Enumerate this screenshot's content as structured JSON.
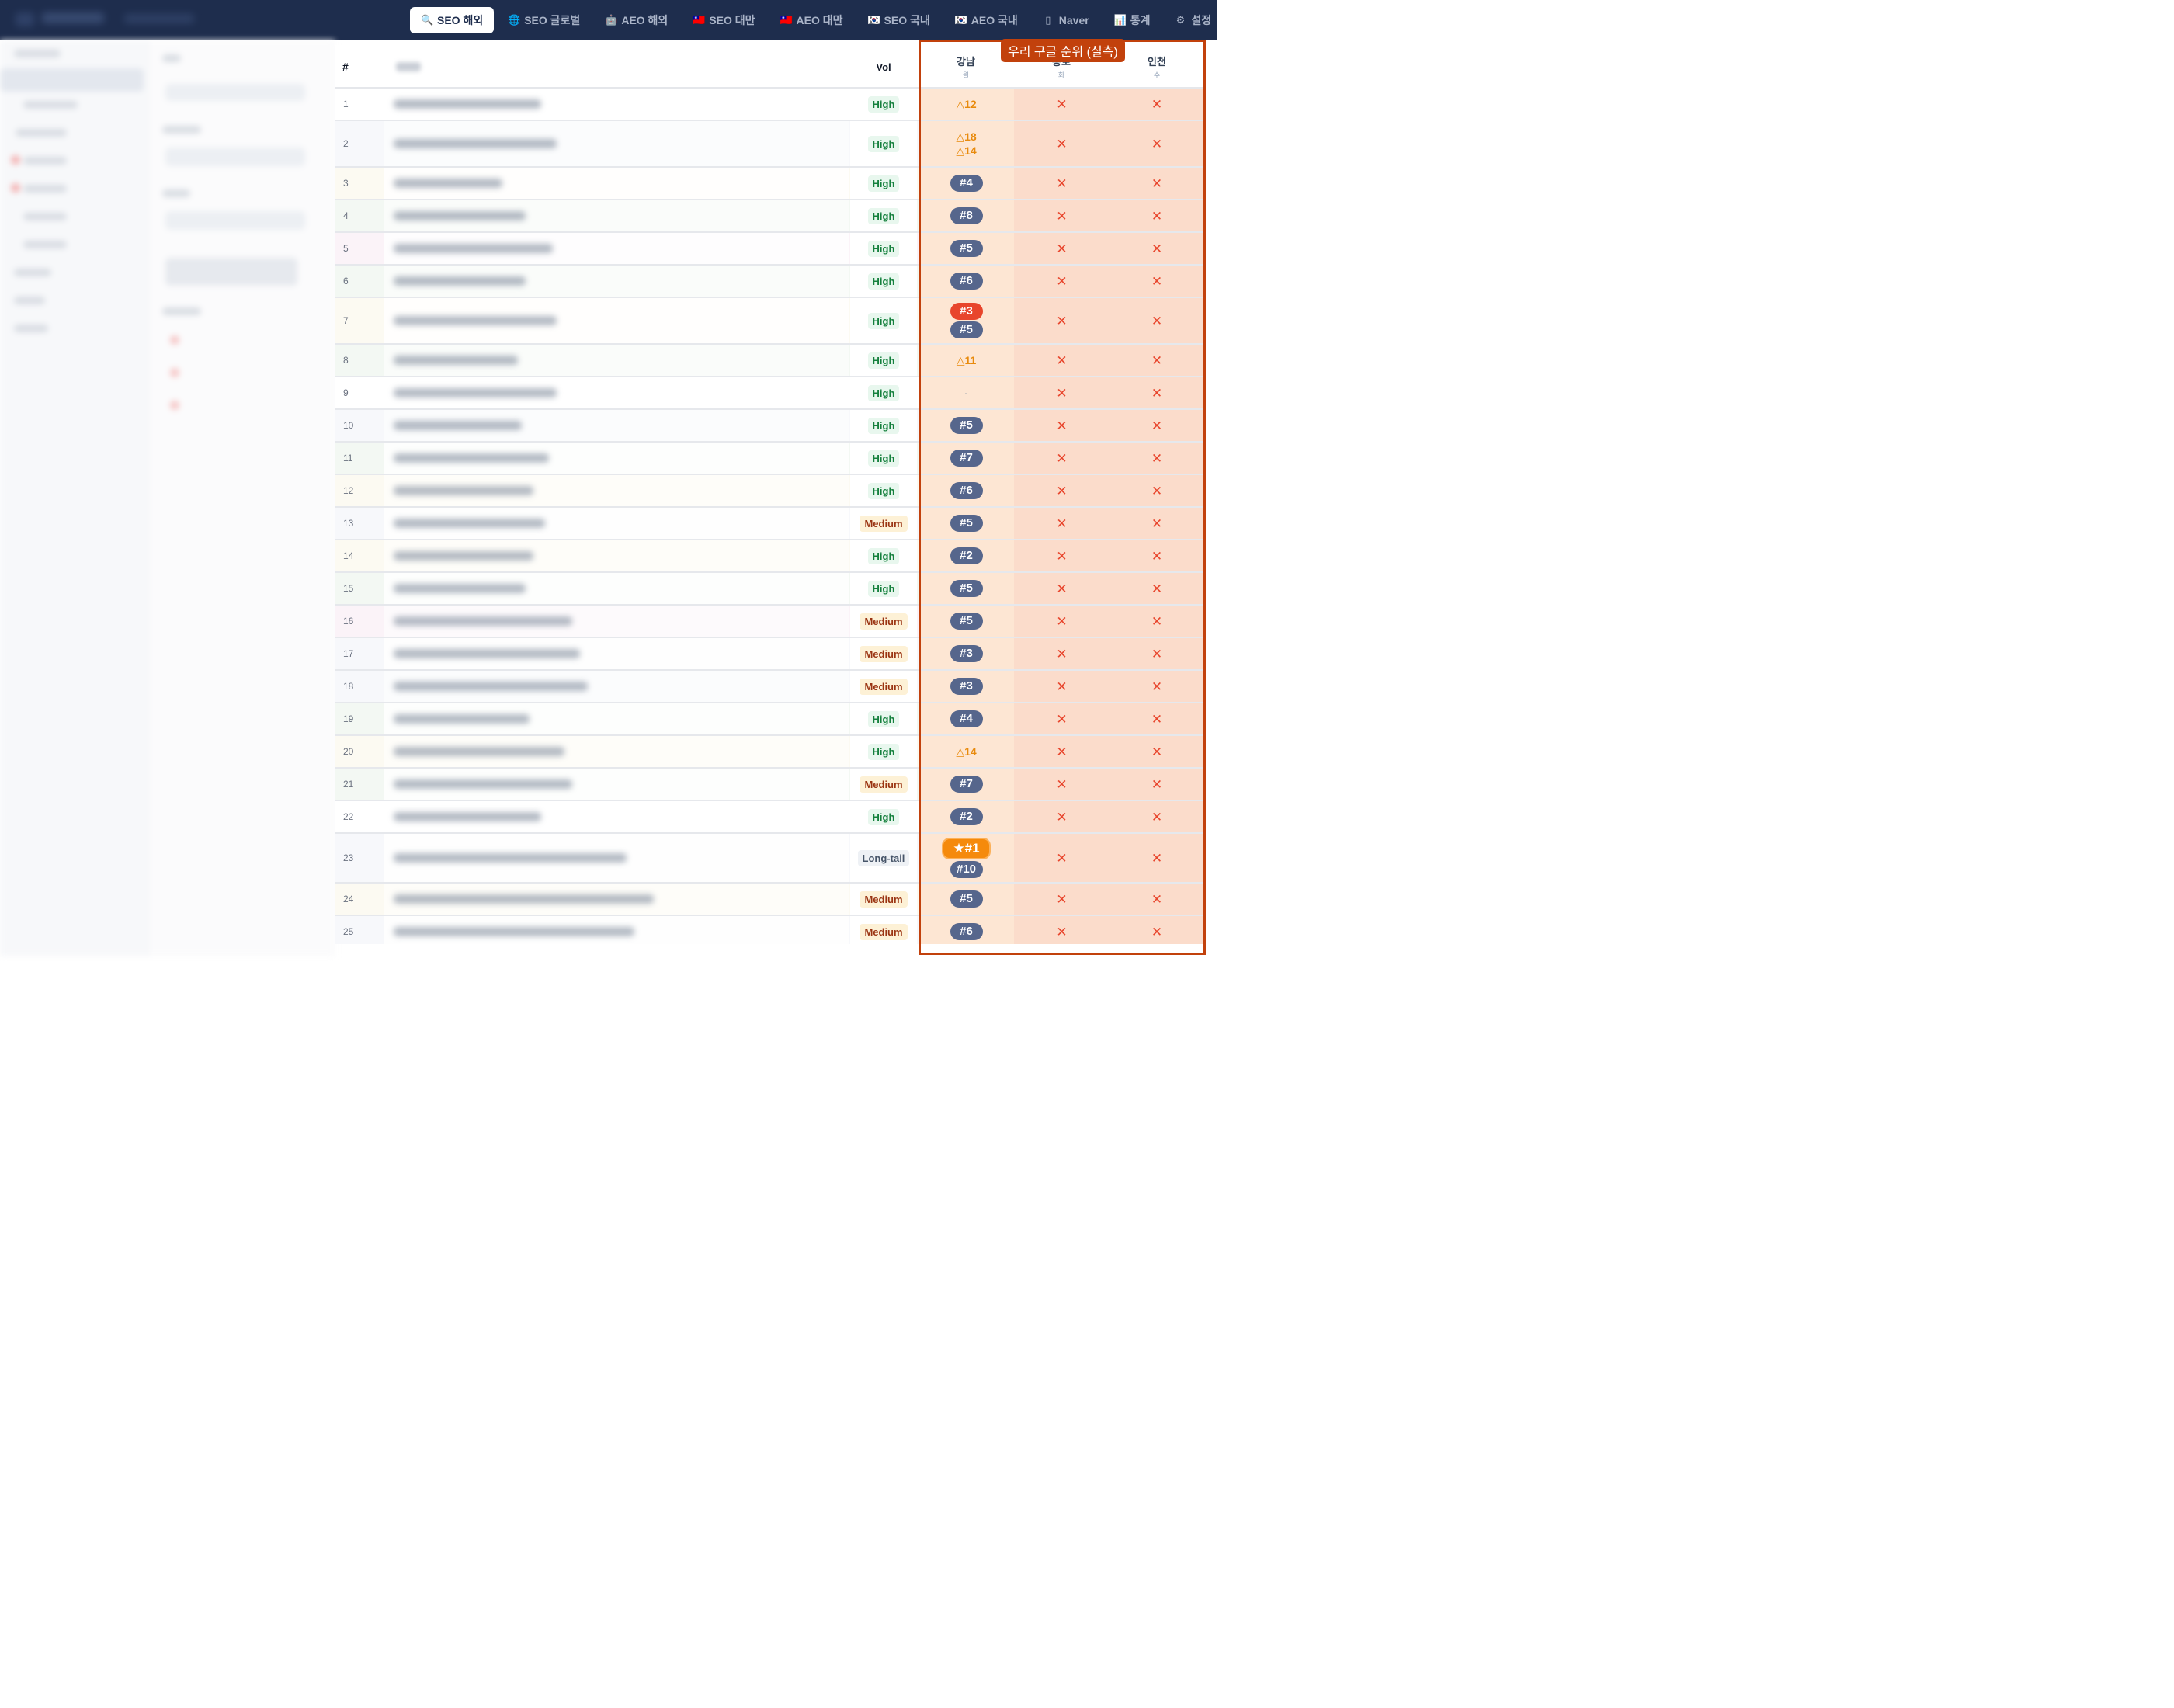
{
  "nav": {
    "tabs": [
      {
        "label": "SEO 해외",
        "icon": "search-icon",
        "glyph": "🔍",
        "active": true
      },
      {
        "label": "SEO 글로벌",
        "icon": "globe-icon",
        "glyph": "🌐",
        "active": false
      },
      {
        "label": "AEO 해외",
        "icon": "robot-icon",
        "glyph": "🤖",
        "active": false
      },
      {
        "label": "SEO 대만",
        "icon": "taiwan-flag-icon",
        "glyph": "🇹🇼",
        "active": false
      },
      {
        "label": "AEO 대만",
        "icon": "taiwan-flag-icon",
        "glyph": "🇹🇼",
        "active": false
      },
      {
        "label": "SEO 국내",
        "icon": "korea-flag-icon",
        "glyph": "🇰🇷",
        "active": false
      },
      {
        "label": "AEO 국내",
        "icon": "korea-flag-icon",
        "glyph": "🇰🇷",
        "active": false
      },
      {
        "label": "Naver",
        "icon": "naver-icon",
        "glyph": "▯",
        "active": false
      },
      {
        "label": "통계",
        "icon": "chart-icon",
        "glyph": "📊",
        "active": false
      },
      {
        "label": "설정",
        "icon": "gear-icon",
        "glyph": "⚙",
        "active": false
      }
    ]
  },
  "highlight": {
    "label": "우리 구글 순위 (실측)"
  },
  "table": {
    "headers": {
      "num": "#",
      "vol": "Vol",
      "locations": [
        {
          "name": "강남",
          "day": "월"
        },
        {
          "name": "종로",
          "day": "화"
        },
        {
          "name": "인천",
          "day": "수"
        }
      ]
    },
    "rows": [
      {
        "n": "1",
        "vol": "High",
        "vclass": "high",
        "rank": [
          {
            "t": "tri",
            "v": "△12"
          }
        ]
      },
      {
        "n": "2",
        "vol": "High",
        "vclass": "high",
        "rank": [
          {
            "t": "tri",
            "v": "△18"
          },
          {
            "t": "tri",
            "v": "△14"
          }
        ]
      },
      {
        "n": "3",
        "vol": "High",
        "vclass": "high",
        "rank": [
          {
            "t": "pill",
            "v": "#4"
          }
        ]
      },
      {
        "n": "4",
        "vol": "High",
        "vclass": "high",
        "rank": [
          {
            "t": "pill",
            "v": "#8"
          }
        ]
      },
      {
        "n": "5",
        "vol": "High",
        "vclass": "high",
        "rank": [
          {
            "t": "pill",
            "v": "#5"
          }
        ]
      },
      {
        "n": "6",
        "vol": "High",
        "vclass": "high",
        "rank": [
          {
            "t": "pill",
            "v": "#6"
          }
        ]
      },
      {
        "n": "7",
        "vol": "High",
        "vclass": "high",
        "rank": [
          {
            "t": "pill red",
            "v": "#3"
          },
          {
            "t": "pill",
            "v": "#5"
          }
        ]
      },
      {
        "n": "8",
        "vol": "High",
        "vclass": "high",
        "rank": [
          {
            "t": "tri",
            "v": "△11"
          }
        ]
      },
      {
        "n": "9",
        "vol": "High",
        "vclass": "high",
        "rank": [
          {
            "t": "dash",
            "v": "-"
          }
        ]
      },
      {
        "n": "10",
        "vol": "High",
        "vclass": "high",
        "rank": [
          {
            "t": "pill",
            "v": "#5"
          }
        ]
      },
      {
        "n": "11",
        "vol": "High",
        "vclass": "high",
        "rank": [
          {
            "t": "pill",
            "v": "#7"
          }
        ]
      },
      {
        "n": "12",
        "vol": "High",
        "vclass": "high",
        "rank": [
          {
            "t": "pill",
            "v": "#6"
          }
        ]
      },
      {
        "n": "13",
        "vol": "Medium",
        "vclass": "medium",
        "rank": [
          {
            "t": "pill",
            "v": "#5"
          }
        ]
      },
      {
        "n": "14",
        "vol": "High",
        "vclass": "high",
        "rank": [
          {
            "t": "pill",
            "v": "#2"
          }
        ]
      },
      {
        "n": "15",
        "vol": "High",
        "vclass": "high",
        "rank": [
          {
            "t": "pill",
            "v": "#5"
          }
        ]
      },
      {
        "n": "16",
        "vol": "Medium",
        "vclass": "medium",
        "rank": [
          {
            "t": "pill",
            "v": "#5"
          }
        ]
      },
      {
        "n": "17",
        "vol": "Medium",
        "vclass": "medium",
        "rank": [
          {
            "t": "pill",
            "v": "#3"
          }
        ]
      },
      {
        "n": "18",
        "vol": "Medium",
        "vclass": "medium",
        "rank": [
          {
            "t": "pill",
            "v": "#3"
          }
        ]
      },
      {
        "n": "19",
        "vol": "High",
        "vclass": "high",
        "rank": [
          {
            "t": "pill",
            "v": "#4"
          }
        ]
      },
      {
        "n": "20",
        "vol": "High",
        "vclass": "high",
        "rank": [
          {
            "t": "tri",
            "v": "△14"
          }
        ]
      },
      {
        "n": "21",
        "vol": "Medium",
        "vclass": "medium",
        "rank": [
          {
            "t": "pill",
            "v": "#7"
          }
        ]
      },
      {
        "n": "22",
        "vol": "High",
        "vclass": "high",
        "rank": [
          {
            "t": "pill",
            "v": "#2"
          }
        ]
      },
      {
        "n": "23",
        "vol": "Long-tail",
        "vclass": "long",
        "rank": [
          {
            "t": "pill star",
            "v": "★#1"
          },
          {
            "t": "pill",
            "v": "#10"
          }
        ]
      },
      {
        "n": "24",
        "vol": "Medium",
        "vclass": "medium",
        "rank": [
          {
            "t": "pill",
            "v": "#5"
          }
        ]
      },
      {
        "n": "25",
        "vol": "Medium",
        "vclass": "medium",
        "rank": [
          {
            "t": "pill",
            "v": "#6"
          }
        ]
      }
    ],
    "missing_mark": "✕"
  }
}
